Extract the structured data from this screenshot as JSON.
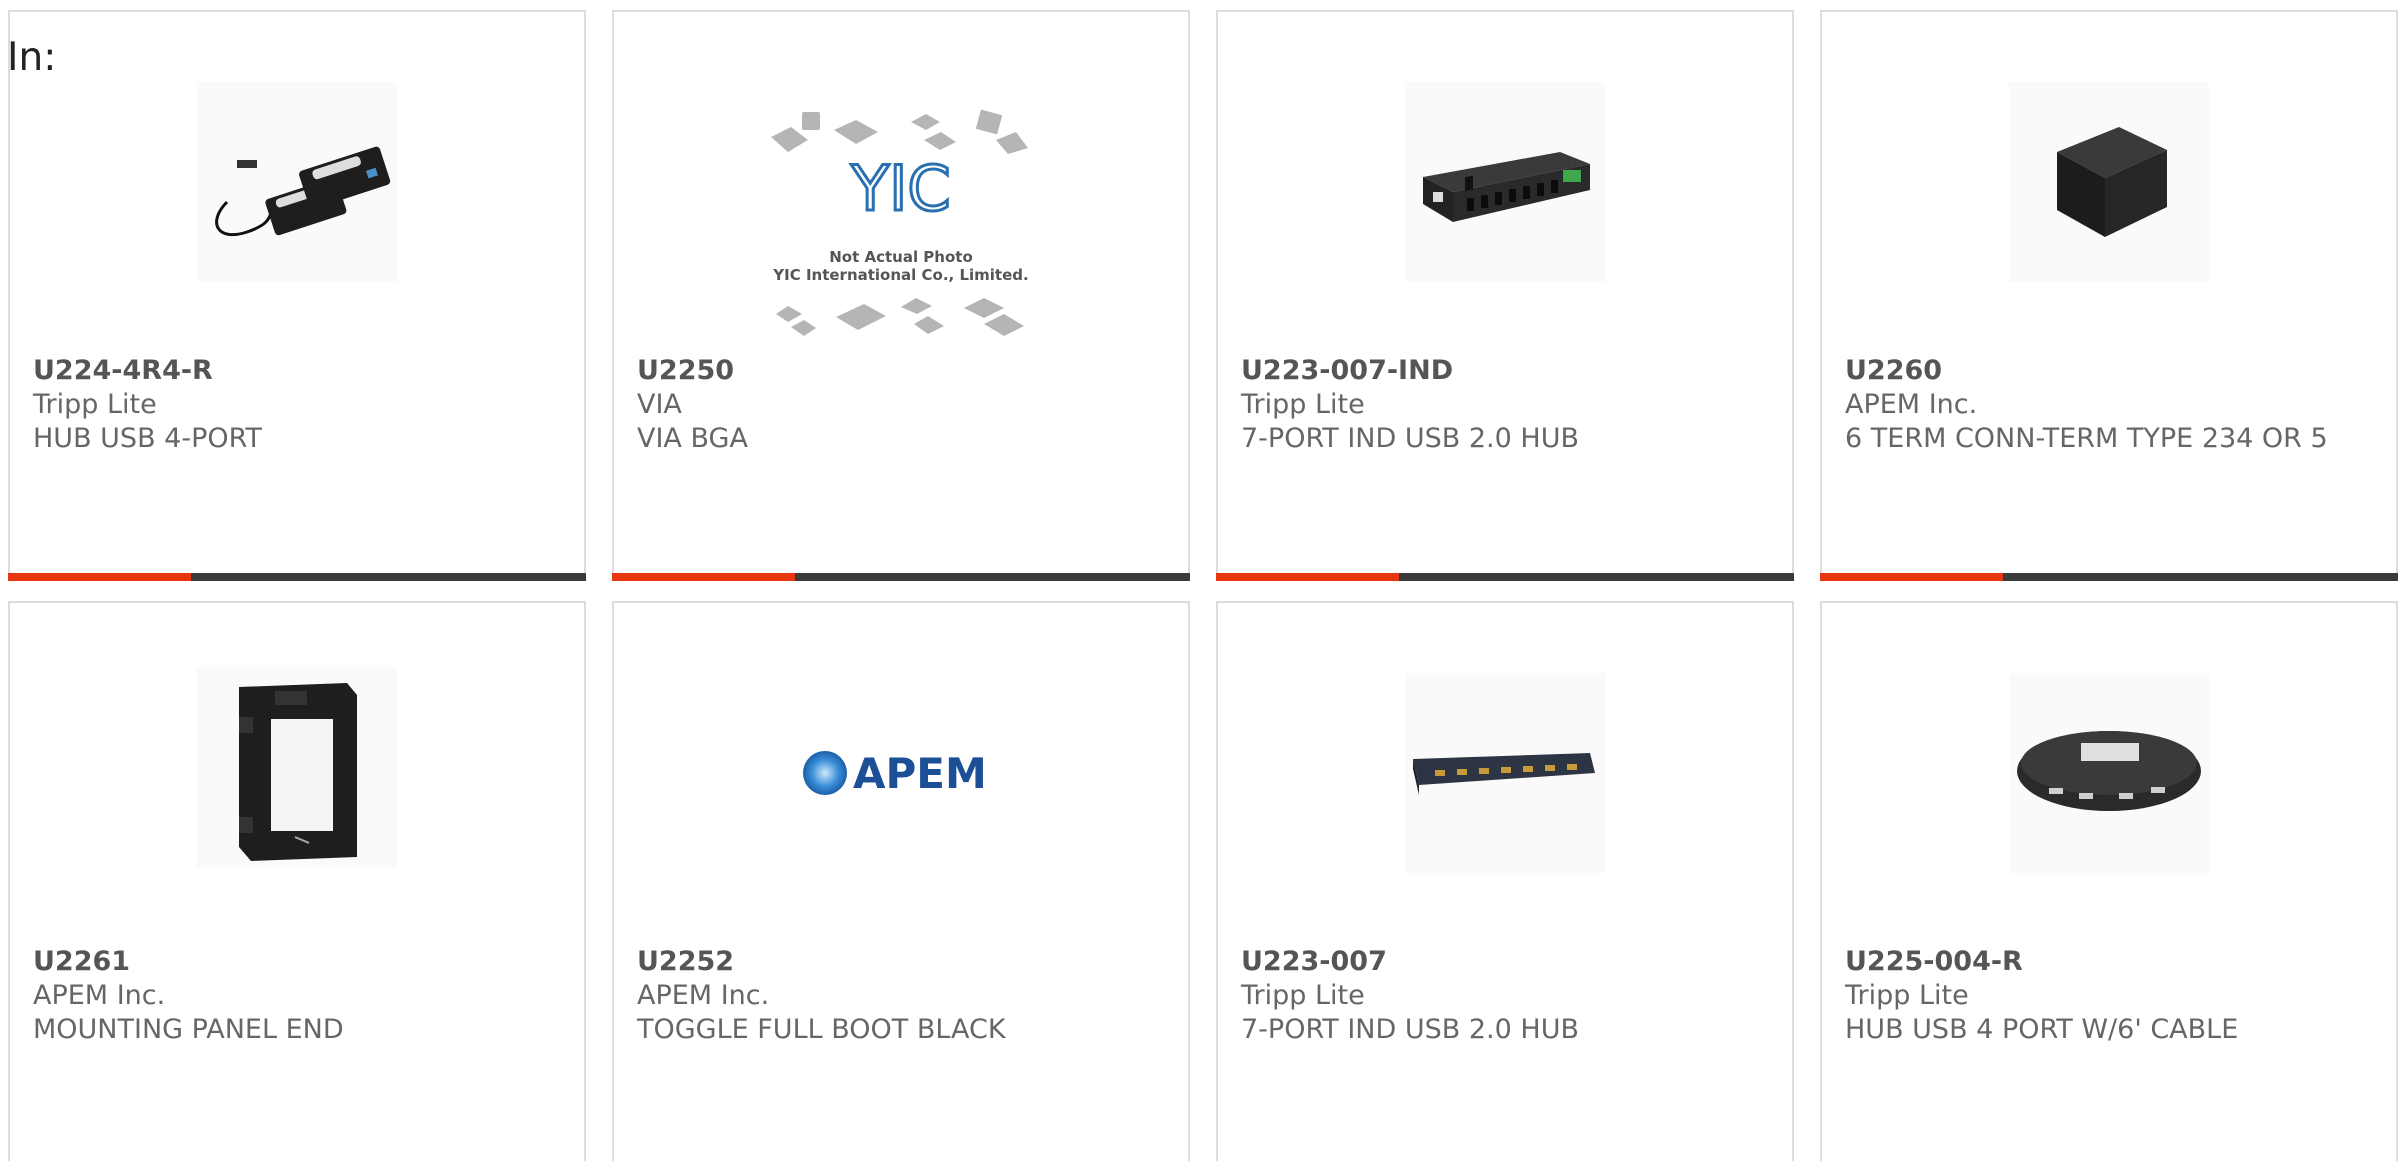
{
  "filter": {
    "label": "In:"
  },
  "products": [
    {
      "part_number": "U224-4R4-R",
      "manufacturer": "Tripp Lite",
      "description": "HUB USB 4-PORT",
      "image_icon": "usb-extender-icon"
    },
    {
      "part_number": "U2250",
      "manufacturer": "VIA",
      "description": "VIA BGA",
      "image_icon": "placeholder-photo-icon",
      "placeholder": {
        "logo": "YIC",
        "line1": "Not Actual Photo",
        "line2": "YIC International Co., Limited."
      }
    },
    {
      "part_number": "U223-007-IND",
      "manufacturer": "Tripp Lite",
      "description": "7-PORT IND USB 2.0 HUB",
      "image_icon": "usb-hub-icon"
    },
    {
      "part_number": "U2260",
      "manufacturer": "APEM Inc.",
      "description": "6 TERM CONN-TERM TYPE 234 OR 5",
      "image_icon": "terminal-block-icon"
    },
    {
      "part_number": "U2261",
      "manufacturer": "APEM Inc.",
      "description": "MOUNTING PANEL END",
      "image_icon": "mounting-panel-icon"
    },
    {
      "part_number": "U2252",
      "manufacturer": "APEM Inc.",
      "description": "TOGGLE FULL BOOT BLACK",
      "image_icon": "apem-logo-icon",
      "logo_text": "APEM"
    },
    {
      "part_number": "U223-007",
      "manufacturer": "Tripp Lite",
      "description": "7-PORT IND USB 2.0 HUB",
      "image_icon": "usb-hub-strip-icon"
    },
    {
      "part_number": "U225-004-R",
      "manufacturer": "Tripp Lite",
      "description": "HUB USB 4 PORT W/6' CABLE",
      "image_icon": "usb-hub-4port-icon"
    }
  ],
  "colors": {
    "accent": "#e8360e",
    "bar": "#3b3b3b",
    "border": "#dcdcdc",
    "text": "#666666"
  }
}
